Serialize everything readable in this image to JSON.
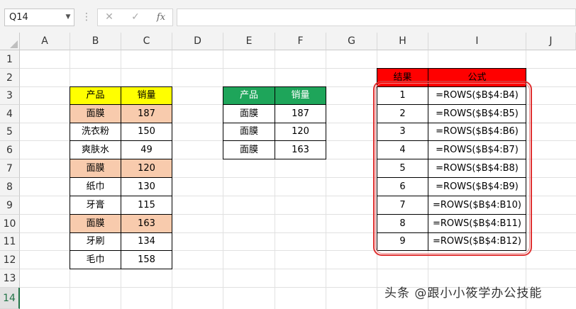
{
  "formula_bar": {
    "name_box": "Q14",
    "separator": "⋮",
    "cancel_icon": "✕",
    "enter_icon": "✓",
    "fx_label": "fx",
    "formula": ""
  },
  "columns": [
    "A",
    "B",
    "C",
    "D",
    "E",
    "F",
    "G",
    "H",
    "I",
    "J"
  ],
  "rows": [
    "1",
    "2",
    "3",
    "4",
    "5",
    "6",
    "7",
    "8",
    "9",
    "10",
    "11",
    "12",
    "13",
    "14"
  ],
  "selected_row": "14",
  "table1": {
    "header": [
      "产品",
      "销量"
    ],
    "rows": [
      [
        "面膜",
        "187"
      ],
      [
        "洗衣粉",
        "150"
      ],
      [
        "爽肤水",
        "49"
      ],
      [
        "面膜",
        "120"
      ],
      [
        "纸巾",
        "130"
      ],
      [
        "牙膏",
        "115"
      ],
      [
        "面膜",
        "163"
      ],
      [
        "牙刷",
        "134"
      ],
      [
        "毛巾",
        "158"
      ]
    ]
  },
  "table2": {
    "header": [
      "产品",
      "销量"
    ],
    "rows": [
      [
        "面膜",
        "187"
      ],
      [
        "面膜",
        "120"
      ],
      [
        "面膜",
        "163"
      ]
    ]
  },
  "table3": {
    "header": [
      "结果",
      "公式"
    ],
    "rows": [
      [
        "1",
        "=ROWS($B$4:B4)"
      ],
      [
        "2",
        "=ROWS($B$4:B5)"
      ],
      [
        "3",
        "=ROWS($B$4:B6)"
      ],
      [
        "4",
        "=ROWS($B$4:B7)"
      ],
      [
        "5",
        "=ROWS($B$4:B8)"
      ],
      [
        "6",
        "=ROWS($B$4:B9)"
      ],
      [
        "7",
        "=ROWS($B$4:B10)"
      ],
      [
        "8",
        "=ROWS($B$4:B11)"
      ],
      [
        "9",
        "=ROWS($B$4:B12)"
      ]
    ]
  },
  "watermark": "头条 @跟小小筱学办公技能",
  "colors": {
    "header_yellow": "#ffff00",
    "header_green": "#1ea55a",
    "header_red": "#ff0000",
    "highlight": "#f8cbad",
    "frame": "#e03030"
  }
}
